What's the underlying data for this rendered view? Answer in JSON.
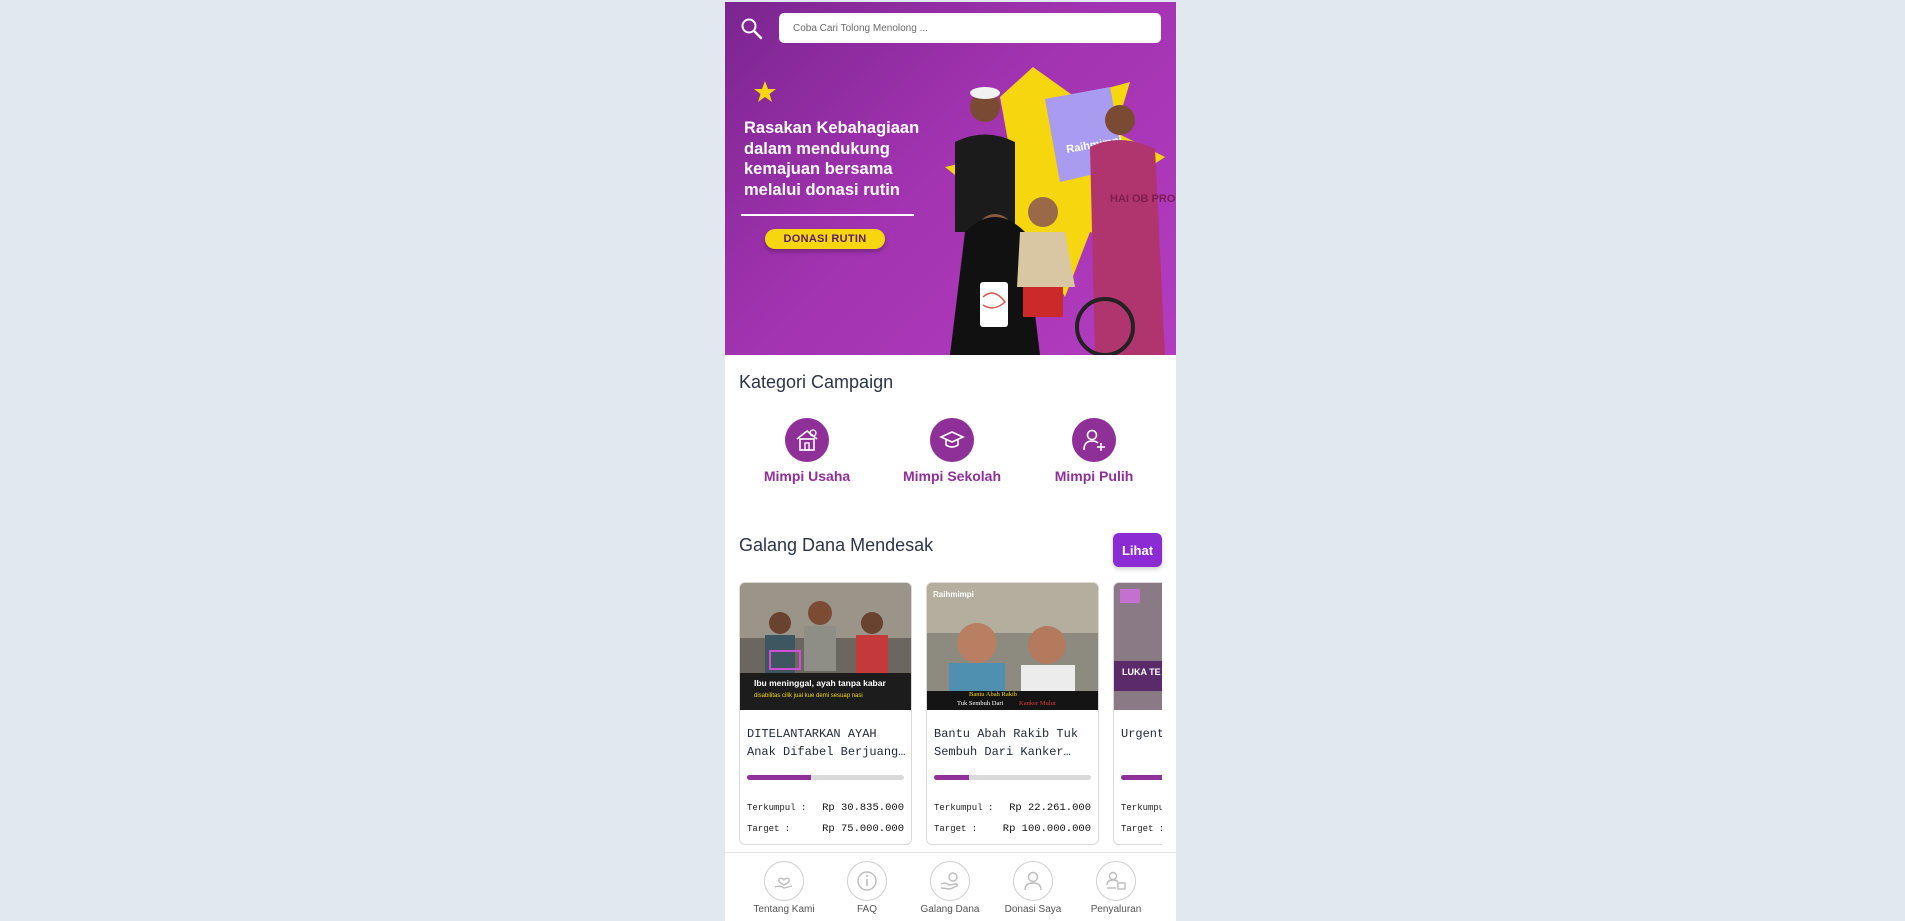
{
  "search": {
    "placeholder": "Coba Cari Tolong Menolong ..."
  },
  "hero": {
    "title": "Rasakan Kebahagiaan dalam mendukung kemajuan bersama melalui donasi rutin",
    "cta_label": "DONASI RUTIN",
    "bag_brand": "Raihmimpi",
    "shirt_text": "HAI OB PRO"
  },
  "categories": {
    "title": "Kategori Campaign",
    "items": [
      {
        "label": "Mimpi Usaha",
        "icon": "house-business-icon"
      },
      {
        "label": "Mimpi Sekolah",
        "icon": "graduation-cap-icon"
      },
      {
        "label": "Mimpi Pulih",
        "icon": "person-plus-icon"
      }
    ]
  },
  "urgent": {
    "title": "Galang Dana Mendesak",
    "see_all_label": "Lihat",
    "collected_label": "Terkumpul :",
    "target_label": "Target :",
    "cards": [
      {
        "title": "DITELANTARKAN AYAH Anak Difabel Berjuang…",
        "image_caption": "Ibu meninggal, ayah tanpa kabar",
        "image_subcaption": "disabilitas cilik jual kue demi sesuap nasi",
        "collected": "Rp 30.835.000",
        "target": "Rp 75.000.000",
        "progress": 0.41
      },
      {
        "title": "Bantu Abah Rakib Tuk Sembuh Dari Kanker…",
        "image_caption_a": "Bantu Abah Rakib",
        "image_caption_b": "Tuk Sembuh Dari",
        "image_caption_c": "Kanker Mulut",
        "image_brand": "Raihmimpi",
        "collected": "Rp 22.261.000",
        "target": "Rp 100.000.000",
        "progress": 0.22
      },
      {
        "title": "Urgent Beroba…",
        "image_caption": "LUKA TE",
        "collected": "",
        "target": "",
        "progress": 0.5
      }
    ]
  },
  "bottom_nav": [
    {
      "label": "Tentang Kami",
      "icon": "heart-hand-icon"
    },
    {
      "label": "FAQ",
      "icon": "info-icon"
    },
    {
      "label": "Galang Dana",
      "icon": "donation-hand-icon"
    },
    {
      "label": "Donasi Saya",
      "icon": "user-icon"
    },
    {
      "label": "Penyaluran",
      "icon": "distribution-icon"
    }
  ],
  "colors": {
    "brand": "#8e3097",
    "cta_yellow": "#f5d60f",
    "button_purple": "#8a2bd4",
    "background": "#e2e8f0"
  }
}
